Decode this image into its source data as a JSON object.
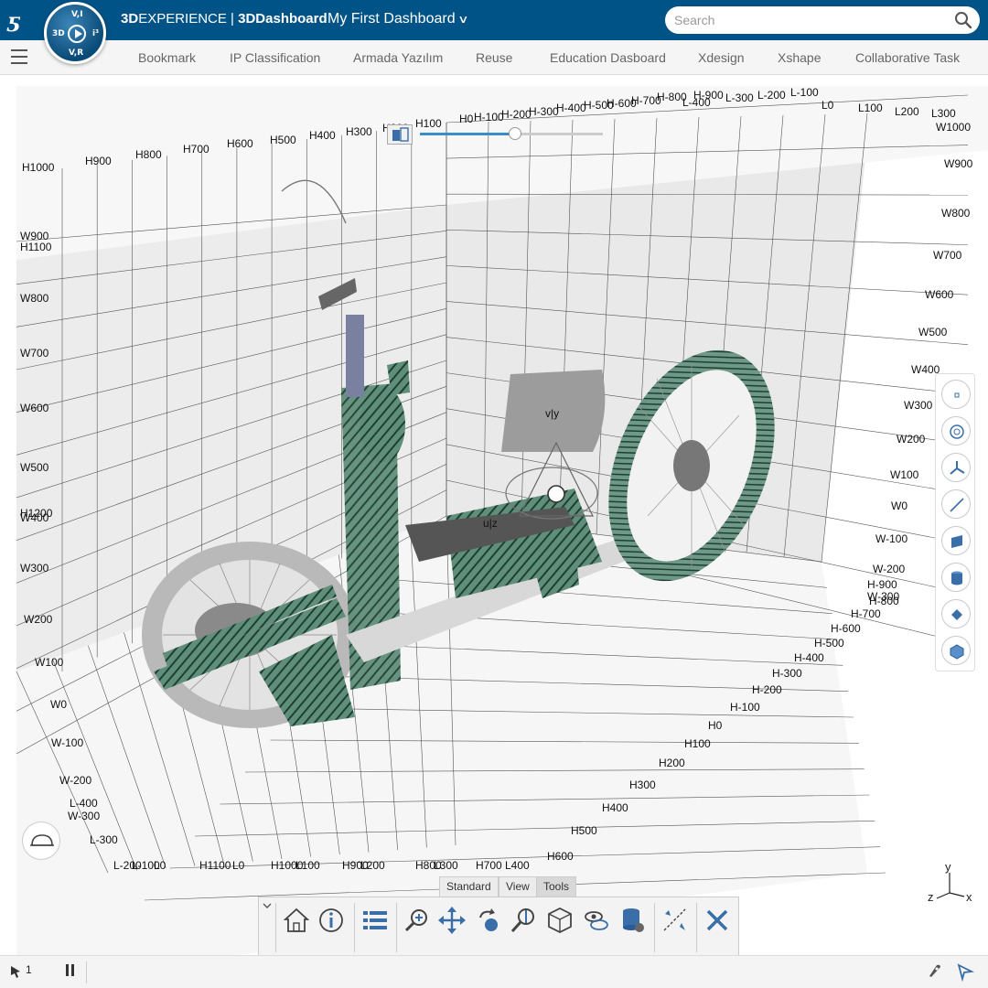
{
  "app": {
    "brand_3d": "3D",
    "brand_experience": "EXPERIENCE",
    "brand_sep": " | ",
    "brand_dashboard": "3DDashboard",
    "dashboard_title": "My First Dashboard",
    "compass_labels": {
      "top": "V,I",
      "left": "3D",
      "right": "i³",
      "bottom": "V,R"
    }
  },
  "search": {
    "placeholder": "Search"
  },
  "tabs": [
    {
      "label": "Bookmark"
    },
    {
      "label": "IP Classification"
    },
    {
      "label": "Armada Yazılım"
    },
    {
      "label": "Reuse"
    },
    {
      "label": "Education Dasboard"
    },
    {
      "label": "Xdesign"
    },
    {
      "label": "Xshape"
    },
    {
      "label": "Collaborative Task"
    }
  ],
  "viewer": {
    "model": "hand-cycle assembly",
    "manipulator_labels": {
      "v_y": "v|y",
      "u_z": "u|z"
    },
    "section_slider": {
      "value": 0.52
    },
    "top_labels": [
      "H1000",
      "H900",
      "H800",
      "H700",
      "H600",
      "H500",
      "H400",
      "H300",
      "H200",
      "H100",
      "H0",
      "H-100",
      "H-200",
      "H-300",
      "H-400",
      "H-500",
      "H-600",
      "H-700",
      "H-800",
      "H-900",
      "L-400",
      "L-300",
      "L-200",
      "L-100",
      "L0",
      "L100",
      "L200",
      "L300"
    ],
    "left_labels": [
      "W900",
      "H1100",
      "W800",
      "W700",
      "W600",
      "W500",
      "H1200",
      "W400",
      "W300",
      "W200",
      "W100",
      "W0",
      "W-100",
      "W-200",
      "L-400",
      "W-300",
      "L-300"
    ],
    "right_labels": [
      "W1000",
      "W900",
      "W800",
      "W700",
      "W600",
      "W500",
      "W400",
      "W300",
      "W200",
      "W100",
      "W0",
      "W-100",
      "W-200",
      "H-900",
      "W-300",
      "H-800",
      "H-700",
      "H-600",
      "H-500",
      "H-400",
      "H-300",
      "H-200",
      "H-100",
      "H0",
      "H100",
      "H200",
      "H300",
      "H400",
      "H500",
      "H600"
    ],
    "bottom_labels": [
      "L-200",
      "L-100",
      "L0",
      "H1100",
      "L0",
      "H1000",
      "L100",
      "H900",
      "L200",
      "H800",
      "L300",
      "H700",
      "L400"
    ]
  },
  "right_toolbar": [
    {
      "icon": "point-icon"
    },
    {
      "icon": "circle-icon"
    },
    {
      "icon": "axis-system-icon"
    },
    {
      "icon": "line-icon"
    },
    {
      "icon": "plane-icon"
    },
    {
      "icon": "cylinder-icon"
    },
    {
      "icon": "rotate-icon"
    },
    {
      "icon": "box-icon"
    }
  ],
  "action_bar": {
    "tabs": [
      "Standard",
      "View",
      "Tools"
    ],
    "active_tab": "Tools",
    "buttons": [
      "home-icon",
      "info-icon",
      "tree-list-icon",
      "zoom-area-icon",
      "pan-icon",
      "rotate-view-icon",
      "zoom-icon",
      "cube-view-icon",
      "hide-show-icon",
      "database-icon",
      "measure-icon",
      "close-icon"
    ]
  },
  "triad": {
    "x": "x",
    "y": "y",
    "z": "z"
  },
  "status": {
    "selection_count": "1"
  },
  "colors": {
    "topbar": "#005386",
    "accent": "#3a8ec8",
    "hatch": "#2f5a47"
  }
}
